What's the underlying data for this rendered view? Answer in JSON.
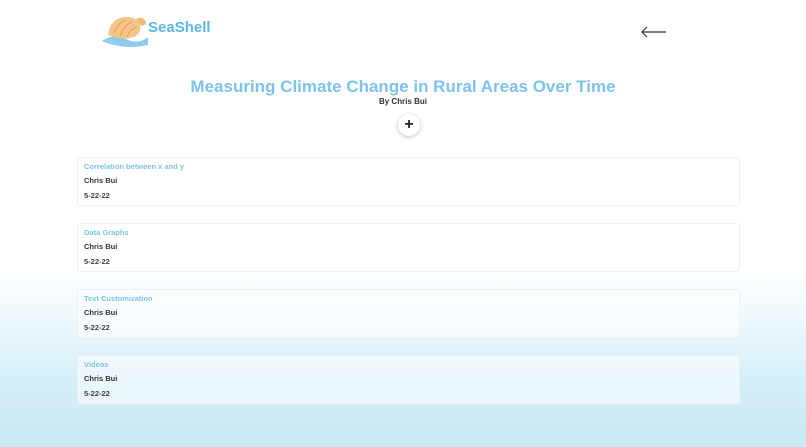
{
  "header": {
    "logo_text": "SeaShell",
    "back_icon": "arrow-left-icon"
  },
  "page": {
    "title": "Measuring Climate Change in Rural Areas Over Time",
    "byline": "By Chris Bui",
    "add_label": "+"
  },
  "cards": [
    {
      "title": "Correlation between x and y",
      "author": "Chris Bui",
      "date": "5-22-22"
    },
    {
      "title": "Data Graphs",
      "author": "Chris Bui",
      "date": "5-22-22"
    },
    {
      "title": "Text Customization",
      "author": "Chris Bui",
      "date": "5-22-22"
    },
    {
      "title": "Videos",
      "author": "Chris Bui",
      "date": "5-22-22"
    }
  ],
  "colors": {
    "accent": "#7dc3ea",
    "brand": "#5bb8e6",
    "shell": "#f4c48a",
    "wave": "#7dc3ea"
  }
}
